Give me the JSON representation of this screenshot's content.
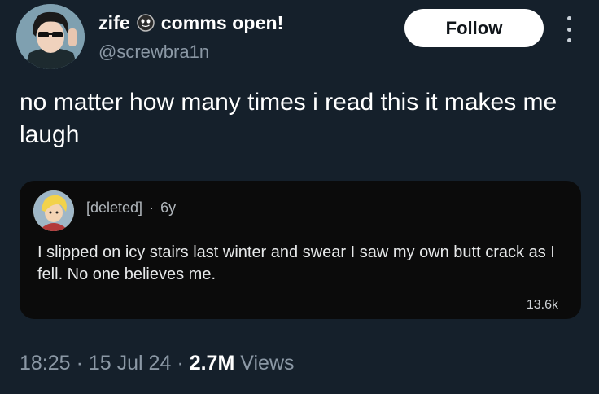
{
  "author": {
    "display_name": "zife",
    "display_suffix": "comms open!",
    "handle": "@screwbra1n",
    "avatar_icon": "avatar-anime-boy-sunglasses",
    "emoji_icon": "smiley-face-icon"
  },
  "actions": {
    "follow_label": "Follow",
    "more_icon": "more-vertical-icon"
  },
  "tweet": {
    "text": "no matter how many times i read this it makes me laugh"
  },
  "quoted_comment": {
    "username": "[deleted]",
    "separator": "·",
    "age": "6y",
    "body": "I slipped on icy stairs last winter and swear I saw my own butt crack as I fell. No one believes me.",
    "score": "13.6k",
    "avatar_icon": "avatar-cartoon-blond"
  },
  "meta": {
    "time": "18:25",
    "dot1": "·",
    "date": "15 Jul 24",
    "dot2": "·",
    "views_count": "2.7M",
    "views_label": "Views"
  },
  "colors": {
    "background": "#15202b",
    "quote_background": "#0b0b0b",
    "muted_text": "#8b98a5",
    "follow_button": "#ffffff"
  }
}
